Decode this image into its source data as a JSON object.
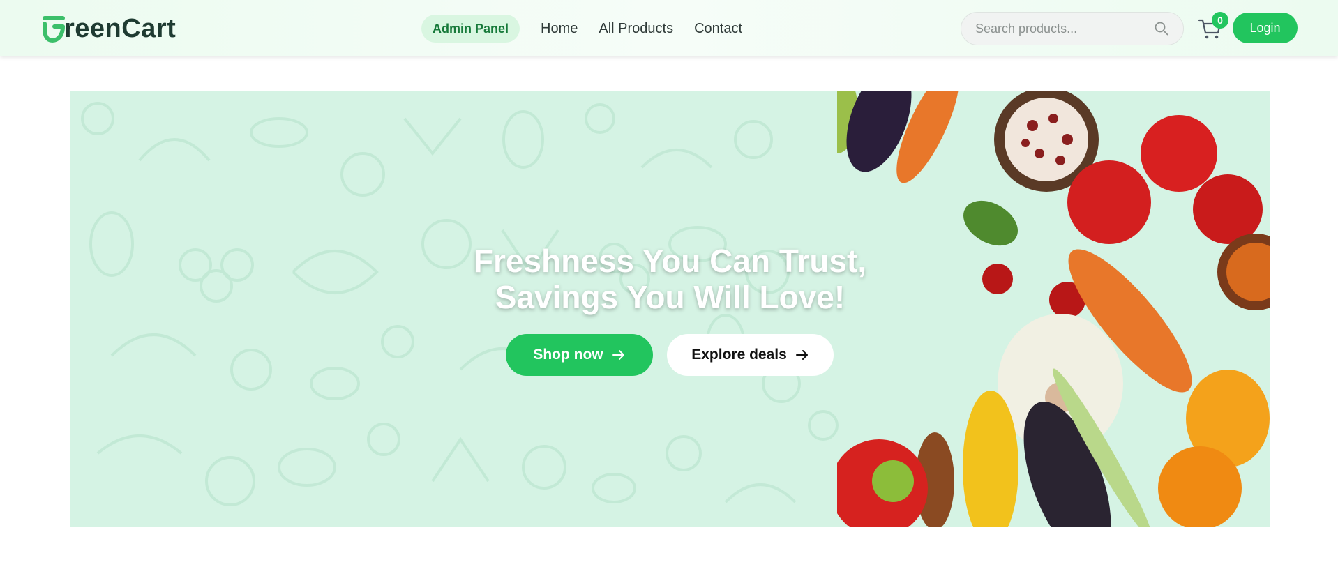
{
  "brand": {
    "name": "reenCart",
    "logo_letter": "G",
    "accent": "#22c55e",
    "dark": "#1f3b32"
  },
  "nav": {
    "admin_label": "Admin Panel",
    "links": [
      "Home",
      "All Products",
      "Contact"
    ]
  },
  "search": {
    "placeholder": "Search products...",
    "icon": "search-icon"
  },
  "cart": {
    "count": "0",
    "icon": "cart-icon"
  },
  "login": {
    "label": "Login"
  },
  "hero": {
    "headline_line1": "Freshness You Can Trust,",
    "headline_line2": "Savings You Will Love!",
    "shop_label": "Shop now",
    "explore_label": "Explore deals",
    "background_color": "#d5f3e4"
  }
}
